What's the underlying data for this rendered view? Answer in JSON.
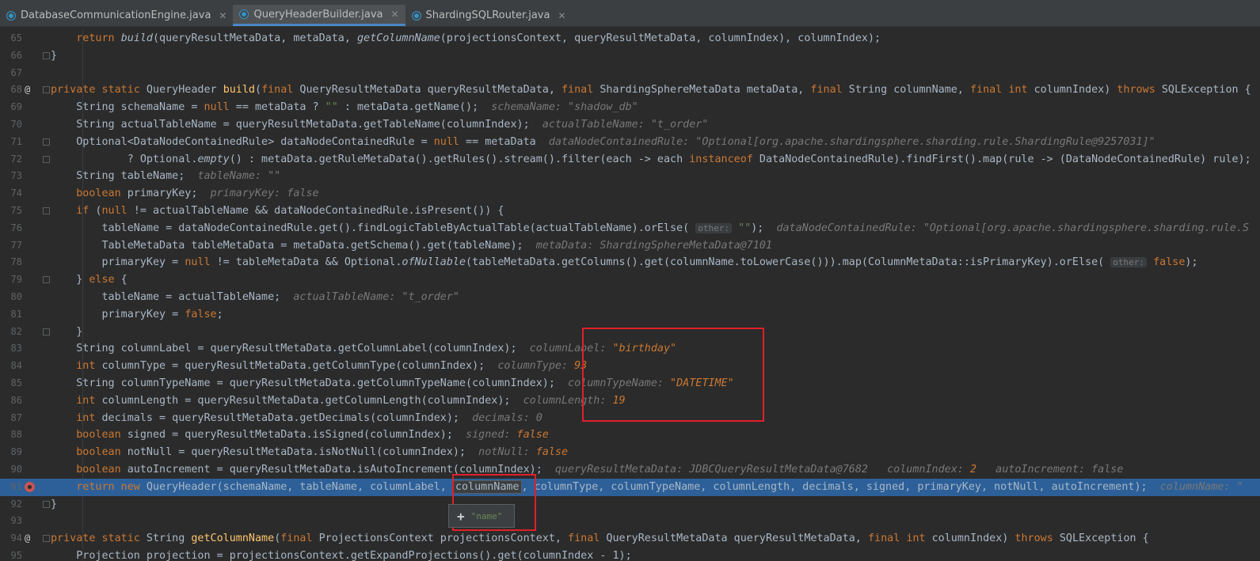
{
  "tabs": [
    {
      "label": "DatabaseCommunicationEngine.java",
      "active": false
    },
    {
      "label": "QueryHeaderBuilder.java",
      "active": true
    },
    {
      "label": "ShardingSQLRouter.java",
      "active": false
    }
  ],
  "tab_close_symbol": "✕",
  "colors": {
    "keyword": "#cc7832",
    "string": "#6a8759",
    "method_decl": "#ffc66d",
    "number": "#6897bb",
    "selected_line": "#2d6099",
    "breakpoint": "#c75450",
    "annotation_box": "#e0202a"
  },
  "popup": {
    "plus": "+",
    "text": "\"name\""
  },
  "lines": [
    {
      "n": "65",
      "html": "    <span class=\"k\">return</span> <span class=\"fi\">build</span>(queryResultMetaData, metaData, <span class=\"fi\">getColumnName</span>(projectionsContext, queryResultMetaData, columnIndex), columnIndex);"
    },
    {
      "n": "66",
      "fold": true,
      "html": "}"
    },
    {
      "n": "67",
      "html": ""
    },
    {
      "n": "68",
      "at": true,
      "fold": true,
      "html": "<span class=\"k\">private static</span> QueryHeader <span class=\"m\">build</span>(<span class=\"k\">final</span> QueryResultMetaData queryResultMetaData, <span class=\"k\">final</span> ShardingSphereMetaData metaData, <span class=\"k\">final</span> String columnName, <span class=\"k\">final int</span> columnIndex) <span class=\"k\">throws</span> SQLException {"
    },
    {
      "n": "69",
      "html": "    String schemaName = <span class=\"k\">null</span> == metaData ? <span class=\"s\">\"\"</span> : metaData.getName();  <span class=\"h\">schemaName: </span><span class=\"h\">\"shadow_db\"</span>"
    },
    {
      "n": "70",
      "html": "    String actualTableName = queryResultMetaData.getTableName(columnIndex);  <span class=\"h\">actualTableName: \"t_order\"</span>"
    },
    {
      "n": "71",
      "fold": true,
      "html": "    Optional&lt;DataNodeContainedRule&gt; dataNodeContainedRule = <span class=\"k\">null</span> == metaData  <span class=\"h\">dataNodeContainedRule: \"Optional[org.apache.shardingsphere.sharding.rule.ShardingRule@9257031]\"</span>"
    },
    {
      "n": "72",
      "fold": true,
      "html": "            ? Optional.<span class=\"fi\">empty</span>() : metaData.getRuleMetaData().getRules().stream().filter(each -&gt; each <span class=\"k\">instanceof</span> DataNodeContainedRule).findFirst().map(rule -&gt; (DataNodeContainedRule) rule);"
    },
    {
      "n": "73",
      "html": "    String tableName;  <span class=\"h\">tableName: \"\"</span>"
    },
    {
      "n": "74",
      "html": "    <span class=\"k\">boolean</span> primaryKey;  <span class=\"h\">primaryKey: false</span>"
    },
    {
      "n": "75",
      "fold": true,
      "html": "    <span class=\"k\">if</span> (<span class=\"k\">null</span> != actualTableName &amp;&amp; dataNodeContainedRule.isPresent()) {"
    },
    {
      "n": "76",
      "html": "        tableName = dataNodeContainedRule.get().findLogicTableByActualTable(actualTableName).orElse( <span class=\"hint\">other:</span> <span class=\"s\">\"\"</span>);  <span class=\"h\">dataNodeContainedRule: \"Optional[org.apache.shardingsphere.sharding.rule.S</span>"
    },
    {
      "n": "77",
      "html": "        TableMetaData tableMetaData = metaData.getSchema().get(tableName);  <span class=\"h\">metaData: ShardingSphereMetaData@7101</span>"
    },
    {
      "n": "78",
      "html": "        primaryKey = <span class=\"k\">null</span> != tableMetaData &amp;&amp; Optional.<span class=\"fi\">ofNullable</span>(tableMetaData.getColumns().get(columnName.toLowerCase())).map(ColumnMetaData::isPrimaryKey).orElse( <span class=\"hint\">other:</span> <span class=\"k\">false</span>);"
    },
    {
      "n": "79",
      "fold": true,
      "html": "    } <span class=\"k\">else</span> {"
    },
    {
      "n": "80",
      "html": "        tableName = actualTableName;  <span class=\"h\">actualTableName: \"t_order\"</span>"
    },
    {
      "n": "81",
      "html": "        primaryKey = <span class=\"k\">false</span>;"
    },
    {
      "n": "82",
      "fold": true,
      "html": "    }"
    },
    {
      "n": "83",
      "html": "    String columnLabel = queryResultMetaData.getColumnLabel(columnIndex);  <span class=\"h\">columnLabel: </span><span class=\"hv\">\"birthday\"</span>"
    },
    {
      "n": "84",
      "html": "    <span class=\"k\">int</span> columnType = queryResultMetaData.getColumnType(columnIndex);  <span class=\"h\">columnType: </span><span class=\"hv\">93</span>"
    },
    {
      "n": "85",
      "html": "    String columnTypeName = queryResultMetaData.getColumnTypeName(columnIndex);  <span class=\"h\">columnTypeName: </span><span class=\"hv\">\"DATETIME\"</span>"
    },
    {
      "n": "86",
      "html": "    <span class=\"k\">int</span> columnLength = queryResultMetaData.getColumnLength(columnIndex);  <span class=\"h\">columnLength: </span><span class=\"hv\">19</span>"
    },
    {
      "n": "87",
      "html": "    <span class=\"k\">int</span> decimals = queryResultMetaData.getDecimals(columnIndex);  <span class=\"h\">decimals: 0</span>"
    },
    {
      "n": "88",
      "html": "    <span class=\"k\">boolean</span> signed = queryResultMetaData.isSigned(columnIndex);  <span class=\"h\">signed: </span><span class=\"hv\">false</span>"
    },
    {
      "n": "89",
      "html": "    <span class=\"k\">boolean</span> notNull = queryResultMetaData.isNotNull(columnIndex);  <span class=\"h\">notNull: </span><span class=\"hv\">false</span>"
    },
    {
      "n": "90",
      "html": "    <span class=\"k\">boolean</span> autoIncrement = queryResultMetaData.isAutoIncrement(columnIndex);  <span class=\"h\">queryResultMetaData: JDBCQueryResultMetaData@7682   columnIndex: </span><span class=\"hv\">2</span><span class=\"h\">   autoIncrement: false</span>"
    },
    {
      "n": "91",
      "bp": true,
      "sel": true,
      "html": "    <span class=\"k\">return new</span> QueryHeader(schemaName, tableName, columnLabel, <span class=\"box\">columnName</span>, columnType, columnTypeName, columnLength, decimals, signed, primaryKey, notNull, autoIncrement);  <span class=\"h\">columnName: \"</span>"
    },
    {
      "n": "92",
      "fold": true,
      "html": "}"
    },
    {
      "n": "93",
      "html": ""
    },
    {
      "n": "94",
      "at": true,
      "fold": true,
      "html": "<span class=\"k\">private static</span> String <span class=\"m\">getColumnName</span>(<span class=\"k\">final</span> ProjectionsContext projectionsContext, <span class=\"k\">final</span> QueryResultMetaData queryResultMetaData, <span class=\"k\">final int</span> columnIndex) <span class=\"k\">throws</span> SQLException {"
    },
    {
      "n": "95",
      "html": "    Projection projection = projectionsContext.getExpandProjections().get(columnIndex - 1);"
    }
  ]
}
